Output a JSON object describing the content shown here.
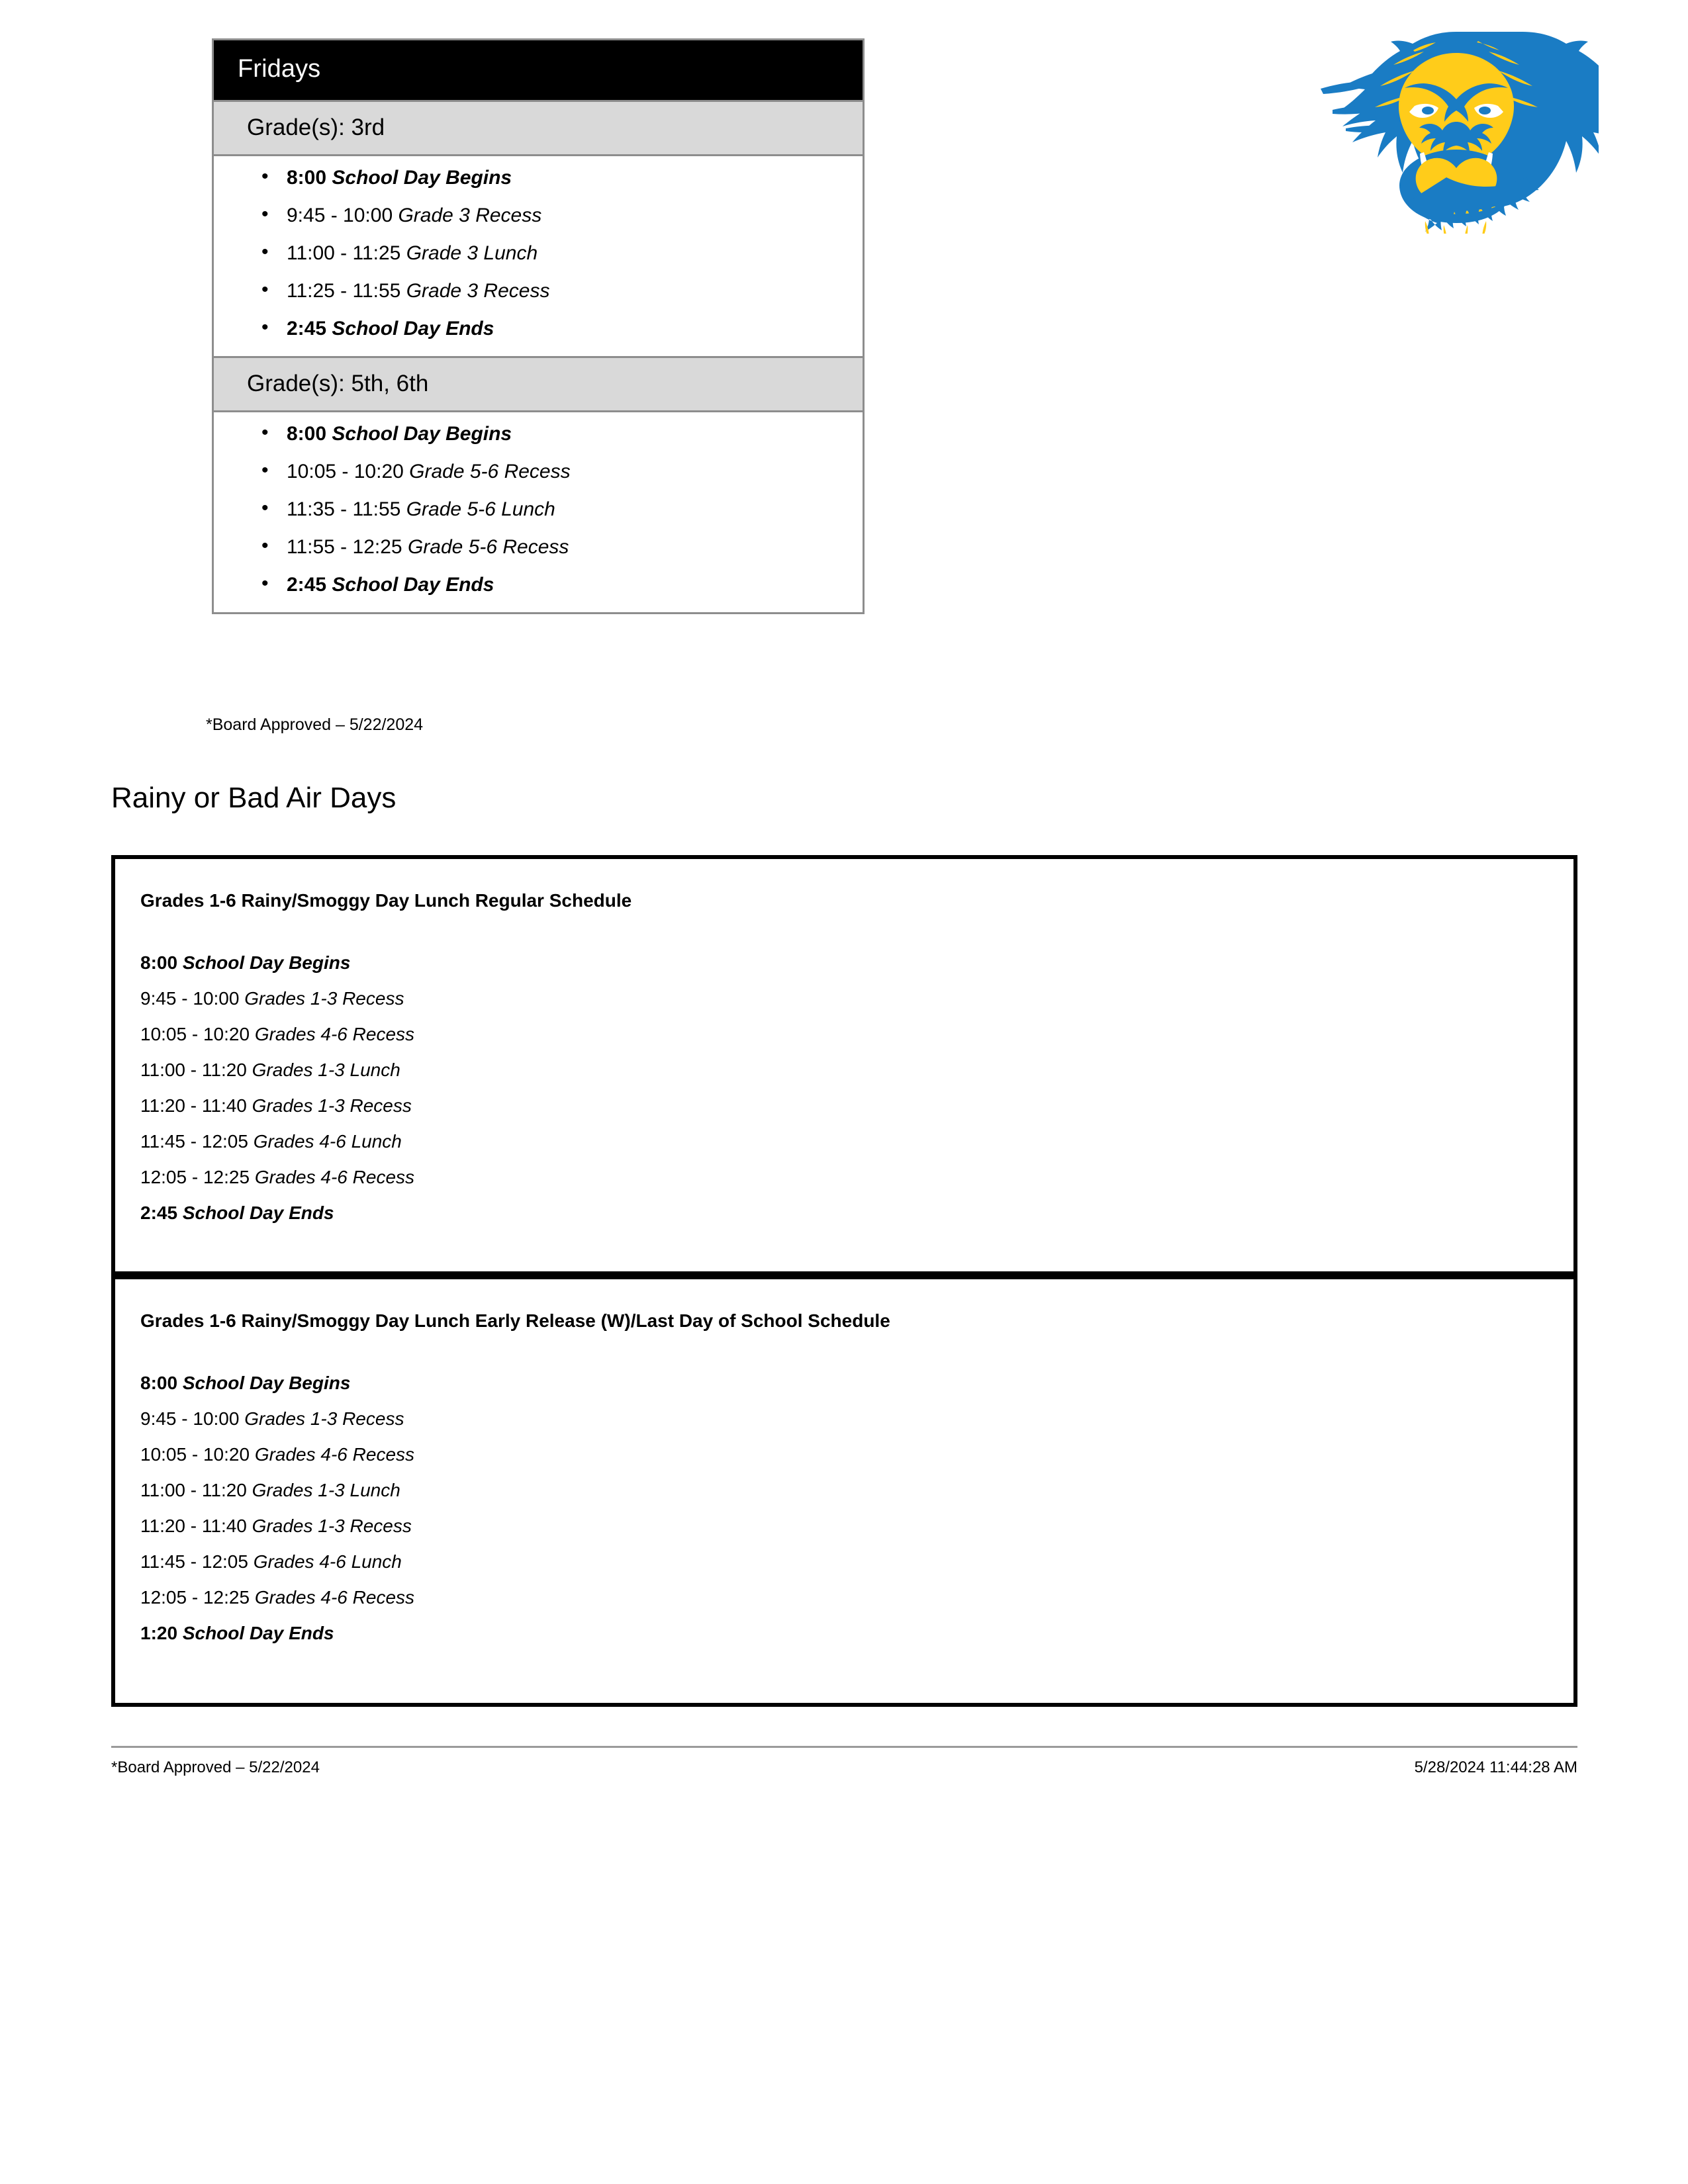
{
  "logo": {
    "icon_name": "wildcat-mascot-head-logo",
    "colors": {
      "blue": "#1A7CC4",
      "gold": "#FFCC1A",
      "white": "#FFFFFF"
    }
  },
  "fridays_table": {
    "title": "Fridays",
    "sections": [
      {
        "grade_label": "Grade(s): 3rd",
        "items": [
          {
            "time": "8:00",
            "label": "School Day Begins",
            "emphasis": true
          },
          {
            "time": "9:45 - 10:00",
            "label": "Grade 3 Recess",
            "emphasis": false
          },
          {
            "time": "11:00 - 11:25",
            "label": "Grade 3 Lunch",
            "emphasis": false
          },
          {
            "time": "11:25 - 11:55",
            "label": "Grade 3 Recess",
            "emphasis": false
          },
          {
            "time": "2:45",
            "label": "School Day Ends",
            "emphasis": true
          }
        ]
      },
      {
        "grade_label": "Grade(s): 5th, 6th",
        "items": [
          {
            "time": "8:00",
            "label": "School Day Begins",
            "emphasis": true
          },
          {
            "time": "10:05 - 10:20",
            "label": "Grade 5-6 Recess",
            "emphasis": false
          },
          {
            "time": "11:35 - 11:55",
            "label": "Grade 5-6 Lunch",
            "emphasis": false
          },
          {
            "time": "11:55 - 12:25",
            "label": "Grade 5-6 Recess",
            "emphasis": false
          },
          {
            "time": "2:45",
            "label": "School Day Ends",
            "emphasis": true
          }
        ]
      }
    ],
    "board_note": "*Board Approved – 5/22/2024"
  },
  "rainy_section": {
    "heading": "Rainy or Bad Air Days",
    "boxes": [
      {
        "title": "Grades 1-6 Rainy/Smoggy Day Lunch Regular Schedule",
        "lines": [
          {
            "time": "8:00",
            "label": "School Day Begins",
            "emphasis": true
          },
          {
            "time": "9:45 - 10:00",
            "label": "Grades 1-3 Recess",
            "emphasis": false
          },
          {
            "time": "10:05 - 10:20",
            "label": "Grades 4-6 Recess",
            "emphasis": false
          },
          {
            "time": "11:00 - 11:20",
            "label": "Grades 1-3 Lunch",
            "emphasis": false
          },
          {
            "time": "11:20 - 11:40",
            "label": "Grades 1-3 Recess",
            "emphasis": false
          },
          {
            "time": "11:45 - 12:05",
            "label": "Grades 4-6 Lunch",
            "emphasis": false
          },
          {
            "time": "12:05 - 12:25",
            "label": "Grades 4-6 Recess",
            "emphasis": false
          },
          {
            "time": "2:45",
            "label": "School Day Ends",
            "emphasis": true
          }
        ]
      },
      {
        "title": "Grades 1-6 Rainy/Smoggy Day Lunch Early Release (W)/Last Day of School Schedule",
        "lines": [
          {
            "time": "8:00",
            "label": "School Day Begins",
            "emphasis": true
          },
          {
            "time": "9:45 - 10:00",
            "label": "Grades 1-3 Recess",
            "emphasis": false
          },
          {
            "time": "10:05 - 10:20",
            "label": "Grades 4-6 Recess",
            "emphasis": false
          },
          {
            "time": "11:00 - 11:20",
            "label": "Grades 1-3 Lunch",
            "emphasis": false
          },
          {
            "time": "11:20 - 11:40",
            "label": "Grades 1-3 Recess",
            "emphasis": false
          },
          {
            "time": "11:45 - 12:05",
            "label": "Grades 4-6 Lunch",
            "emphasis": false
          },
          {
            "time": "12:05 - 12:25",
            "label": "Grades 4-6 Recess",
            "emphasis": false
          },
          {
            "time": "1:20",
            "label": "School Day Ends",
            "emphasis": true
          }
        ]
      }
    ]
  },
  "footer": {
    "left": "*Board Approved – 5/22/2024",
    "right": "5/28/2024 11:44:28 AM"
  }
}
